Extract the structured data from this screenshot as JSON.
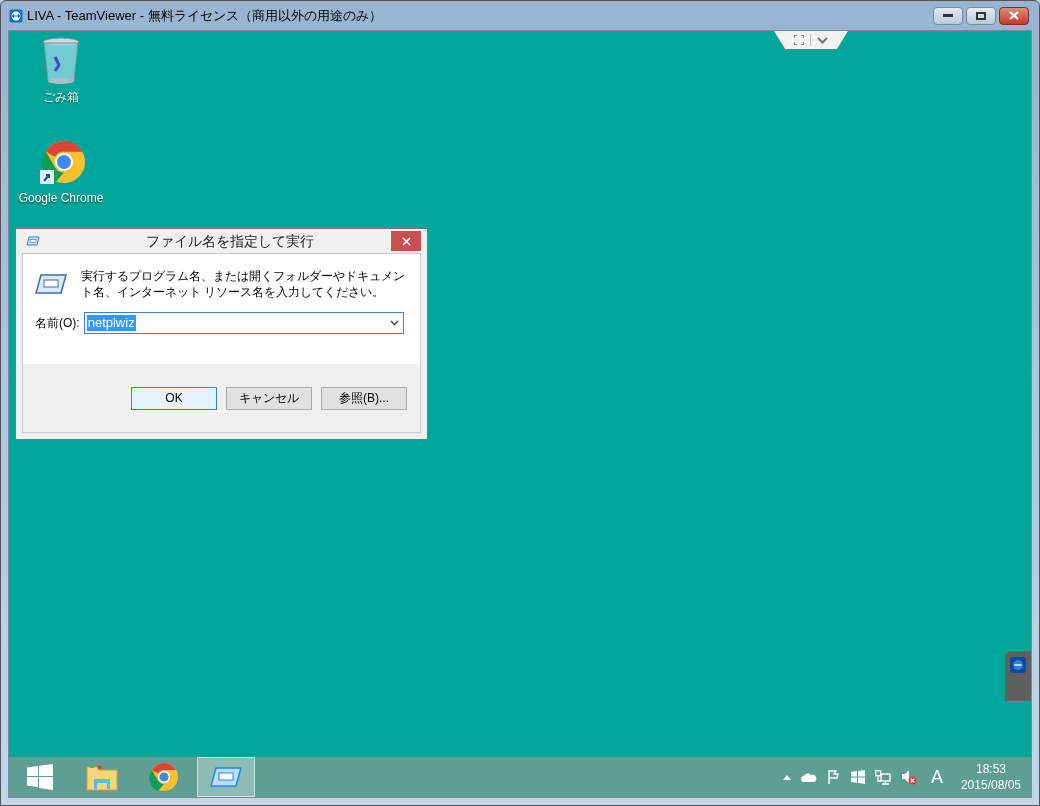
{
  "window": {
    "title": "LIVA - TeamViewer - 無料ライセンス（商用以外の用途のみ）"
  },
  "desktop_icons": [
    {
      "kind": "recycle-bin",
      "label": "ごみ箱"
    },
    {
      "kind": "chrome",
      "label": "Google Chrome"
    }
  ],
  "dialog": {
    "title": "ファイル名を指定して実行",
    "message": "実行するプログラム名、または開くフォルダーやドキュメント名、インターネット リソース名を入力してください。",
    "field_label": "名前(O):",
    "value": "netplwiz",
    "value_selected": true,
    "buttons": [
      {
        "label": "OK",
        "default": true
      },
      {
        "label": "キャンセル",
        "default": false
      },
      {
        "label": "参照(B)...",
        "default": false
      }
    ]
  },
  "taskbar": {
    "items": [
      {
        "kind": "start",
        "selected": false
      },
      {
        "kind": "explorer",
        "selected": false
      },
      {
        "kind": "chrome",
        "selected": false
      },
      {
        "kind": "run",
        "selected": true
      }
    ],
    "ime": "A",
    "time": "18:53",
    "date": "2015/08/05"
  }
}
